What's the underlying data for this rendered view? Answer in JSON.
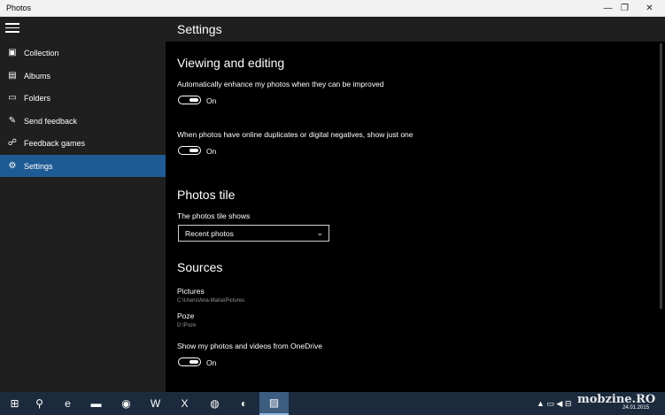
{
  "window": {
    "title": "Photos",
    "min_glyph": "—",
    "max_glyph": "❐",
    "close_glyph": "✕"
  },
  "sidebar": {
    "items": [
      {
        "label": "Collection",
        "icon": "photo-icon",
        "glyph": "▣"
      },
      {
        "label": "Albums",
        "icon": "album-icon",
        "glyph": "▤"
      },
      {
        "label": "Folders",
        "icon": "folder-icon",
        "glyph": "▭"
      },
      {
        "label": "Send feedback",
        "icon": "feedback-icon",
        "glyph": "✎"
      },
      {
        "label": "Feedback games",
        "icon": "games-icon",
        "glyph": "☍"
      },
      {
        "label": "Settings",
        "icon": "gear-icon",
        "glyph": "⚙",
        "active": true
      }
    ]
  },
  "header": {
    "title": "Settings"
  },
  "viewing": {
    "heading": "Viewing and editing",
    "enhance_label": "Automatically enhance my photos when they can be improved",
    "enhance_state": "On",
    "duplicates_label": "When photos have online duplicates or digital negatives, show just one",
    "duplicates_state": "On"
  },
  "tile": {
    "heading": "Photos tile",
    "label": "The photos tile shows",
    "selected": "Recent photos",
    "chevron": "⌄"
  },
  "sources": {
    "heading": "Sources",
    "items": [
      {
        "name": "Pictures",
        "path": "C:\\Users\\Ana-Maria\\Pictures"
      },
      {
        "name": "Poze",
        "path": "D:\\Poze"
      }
    ],
    "onedrive_label": "Show my photos and videos from OneDrive",
    "onedrive_state": "On"
  },
  "taskbar": {
    "watermark": "mobzine.RO",
    "date": "24.01.2015",
    "apps": [
      {
        "icon": "windows-start-icon",
        "glyph": "⊞"
      },
      {
        "icon": "search-icon",
        "glyph": "⚲"
      },
      {
        "icon": "internet-explorer-icon",
        "glyph": "e"
      },
      {
        "icon": "file-explorer-icon",
        "glyph": "▬"
      },
      {
        "icon": "chrome-icon",
        "glyph": "◉"
      },
      {
        "icon": "word-icon",
        "glyph": "W"
      },
      {
        "icon": "excel-icon",
        "glyph": "X"
      },
      {
        "icon": "app-icon-1",
        "glyph": "◍"
      },
      {
        "icon": "app-icon-2",
        "glyph": "◐"
      },
      {
        "icon": "photos-app-icon",
        "glyph": "▨",
        "active": true
      }
    ],
    "tray_glyphs": "▲ ▭ ◀ ⊟"
  },
  "colors": {
    "accent": "#1e5a93",
    "sidebar": "#1f1f1f",
    "content": "#000000",
    "taskbar": "#1b2b3d"
  }
}
